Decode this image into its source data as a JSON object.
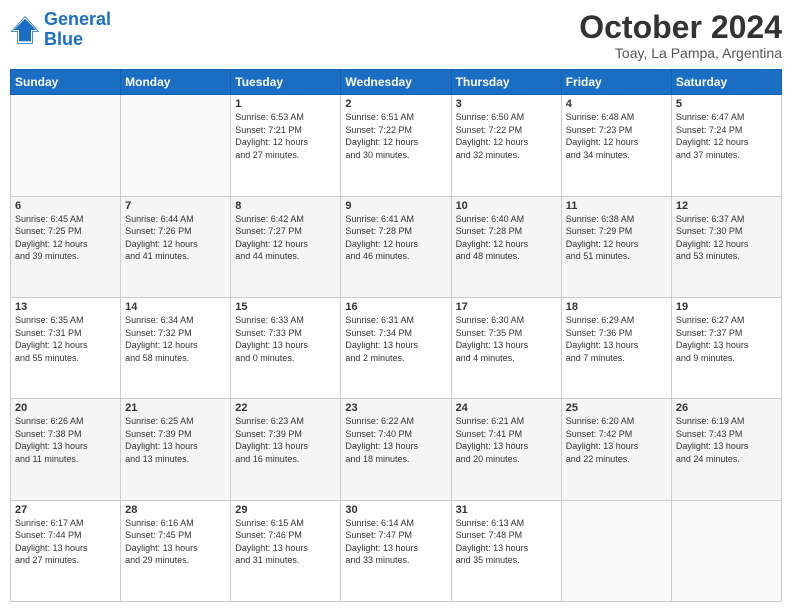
{
  "logo": {
    "line1": "General",
    "line2": "Blue"
  },
  "header": {
    "month": "October 2024",
    "location": "Toay, La Pampa, Argentina"
  },
  "weekdays": [
    "Sunday",
    "Monday",
    "Tuesday",
    "Wednesday",
    "Thursday",
    "Friday",
    "Saturday"
  ],
  "weeks": [
    [
      {
        "day": "",
        "info": ""
      },
      {
        "day": "",
        "info": ""
      },
      {
        "day": "1",
        "info": "Sunrise: 6:53 AM\nSunset: 7:21 PM\nDaylight: 12 hours\nand 27 minutes."
      },
      {
        "day": "2",
        "info": "Sunrise: 6:51 AM\nSunset: 7:22 PM\nDaylight: 12 hours\nand 30 minutes."
      },
      {
        "day": "3",
        "info": "Sunrise: 6:50 AM\nSunset: 7:22 PM\nDaylight: 12 hours\nand 32 minutes."
      },
      {
        "day": "4",
        "info": "Sunrise: 6:48 AM\nSunset: 7:23 PM\nDaylight: 12 hours\nand 34 minutes."
      },
      {
        "day": "5",
        "info": "Sunrise: 6:47 AM\nSunset: 7:24 PM\nDaylight: 12 hours\nand 37 minutes."
      }
    ],
    [
      {
        "day": "6",
        "info": "Sunrise: 6:45 AM\nSunset: 7:25 PM\nDaylight: 12 hours\nand 39 minutes."
      },
      {
        "day": "7",
        "info": "Sunrise: 6:44 AM\nSunset: 7:26 PM\nDaylight: 12 hours\nand 41 minutes."
      },
      {
        "day": "8",
        "info": "Sunrise: 6:42 AM\nSunset: 7:27 PM\nDaylight: 12 hours\nand 44 minutes."
      },
      {
        "day": "9",
        "info": "Sunrise: 6:41 AM\nSunset: 7:28 PM\nDaylight: 12 hours\nand 46 minutes."
      },
      {
        "day": "10",
        "info": "Sunrise: 6:40 AM\nSunset: 7:28 PM\nDaylight: 12 hours\nand 48 minutes."
      },
      {
        "day": "11",
        "info": "Sunrise: 6:38 AM\nSunset: 7:29 PM\nDaylight: 12 hours\nand 51 minutes."
      },
      {
        "day": "12",
        "info": "Sunrise: 6:37 AM\nSunset: 7:30 PM\nDaylight: 12 hours\nand 53 minutes."
      }
    ],
    [
      {
        "day": "13",
        "info": "Sunrise: 6:35 AM\nSunset: 7:31 PM\nDaylight: 12 hours\nand 55 minutes."
      },
      {
        "day": "14",
        "info": "Sunrise: 6:34 AM\nSunset: 7:32 PM\nDaylight: 12 hours\nand 58 minutes."
      },
      {
        "day": "15",
        "info": "Sunrise: 6:33 AM\nSunset: 7:33 PM\nDaylight: 13 hours\nand 0 minutes."
      },
      {
        "day": "16",
        "info": "Sunrise: 6:31 AM\nSunset: 7:34 PM\nDaylight: 13 hours\nand 2 minutes."
      },
      {
        "day": "17",
        "info": "Sunrise: 6:30 AM\nSunset: 7:35 PM\nDaylight: 13 hours\nand 4 minutes."
      },
      {
        "day": "18",
        "info": "Sunrise: 6:29 AM\nSunset: 7:36 PM\nDaylight: 13 hours\nand 7 minutes."
      },
      {
        "day": "19",
        "info": "Sunrise: 6:27 AM\nSunset: 7:37 PM\nDaylight: 13 hours\nand 9 minutes."
      }
    ],
    [
      {
        "day": "20",
        "info": "Sunrise: 6:26 AM\nSunset: 7:38 PM\nDaylight: 13 hours\nand 11 minutes."
      },
      {
        "day": "21",
        "info": "Sunrise: 6:25 AM\nSunset: 7:39 PM\nDaylight: 13 hours\nand 13 minutes."
      },
      {
        "day": "22",
        "info": "Sunrise: 6:23 AM\nSunset: 7:39 PM\nDaylight: 13 hours\nand 16 minutes."
      },
      {
        "day": "23",
        "info": "Sunrise: 6:22 AM\nSunset: 7:40 PM\nDaylight: 13 hours\nand 18 minutes."
      },
      {
        "day": "24",
        "info": "Sunrise: 6:21 AM\nSunset: 7:41 PM\nDaylight: 13 hours\nand 20 minutes."
      },
      {
        "day": "25",
        "info": "Sunrise: 6:20 AM\nSunset: 7:42 PM\nDaylight: 13 hours\nand 22 minutes."
      },
      {
        "day": "26",
        "info": "Sunrise: 6:19 AM\nSunset: 7:43 PM\nDaylight: 13 hours\nand 24 minutes."
      }
    ],
    [
      {
        "day": "27",
        "info": "Sunrise: 6:17 AM\nSunset: 7:44 PM\nDaylight: 13 hours\nand 27 minutes."
      },
      {
        "day": "28",
        "info": "Sunrise: 6:16 AM\nSunset: 7:45 PM\nDaylight: 13 hours\nand 29 minutes."
      },
      {
        "day": "29",
        "info": "Sunrise: 6:15 AM\nSunset: 7:46 PM\nDaylight: 13 hours\nand 31 minutes."
      },
      {
        "day": "30",
        "info": "Sunrise: 6:14 AM\nSunset: 7:47 PM\nDaylight: 13 hours\nand 33 minutes."
      },
      {
        "day": "31",
        "info": "Sunrise: 6:13 AM\nSunset: 7:48 PM\nDaylight: 13 hours\nand 35 minutes."
      },
      {
        "day": "",
        "info": ""
      },
      {
        "day": "",
        "info": ""
      }
    ]
  ]
}
